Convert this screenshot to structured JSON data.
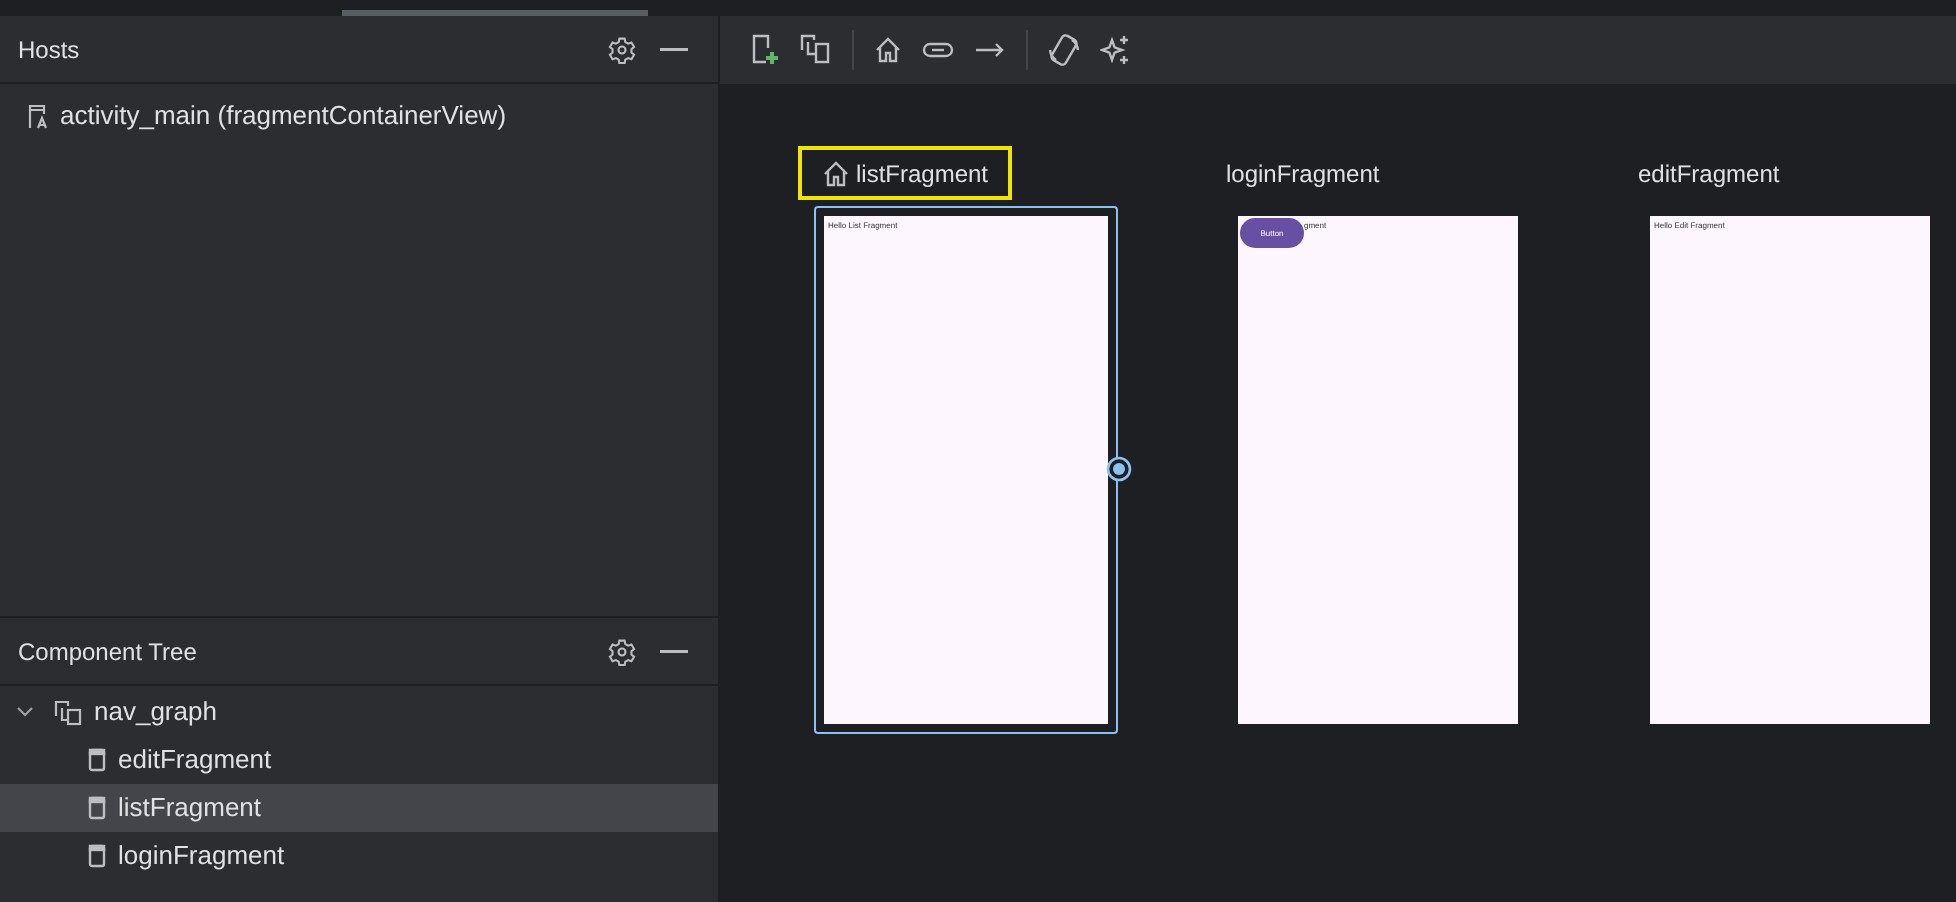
{
  "hosts": {
    "title": "Hosts",
    "items": [
      {
        "label": "activity_main (fragmentContainerView)"
      }
    ]
  },
  "component_tree": {
    "title": "Component Tree",
    "items": [
      {
        "label": "nav_graph",
        "kind": "graph",
        "expanded": true,
        "selected": false,
        "children": [
          {
            "label": "editFragment",
            "kind": "fragment",
            "selected": false
          },
          {
            "label": "listFragment",
            "kind": "fragment",
            "selected": true
          },
          {
            "label": "loginFragment",
            "kind": "fragment",
            "selected": false
          }
        ]
      }
    ]
  },
  "destinations": [
    {
      "label": "listFragment",
      "start": true,
      "selected": true,
      "preview": {
        "text": "Hello List Fragment"
      }
    },
    {
      "label": "loginFragment",
      "start": false,
      "selected": false,
      "preview": {
        "text": "gment",
        "button": "Button"
      }
    },
    {
      "label": "editFragment",
      "start": false,
      "selected": false,
      "preview": {
        "text": "Hello Edit Fragment"
      }
    }
  ]
}
